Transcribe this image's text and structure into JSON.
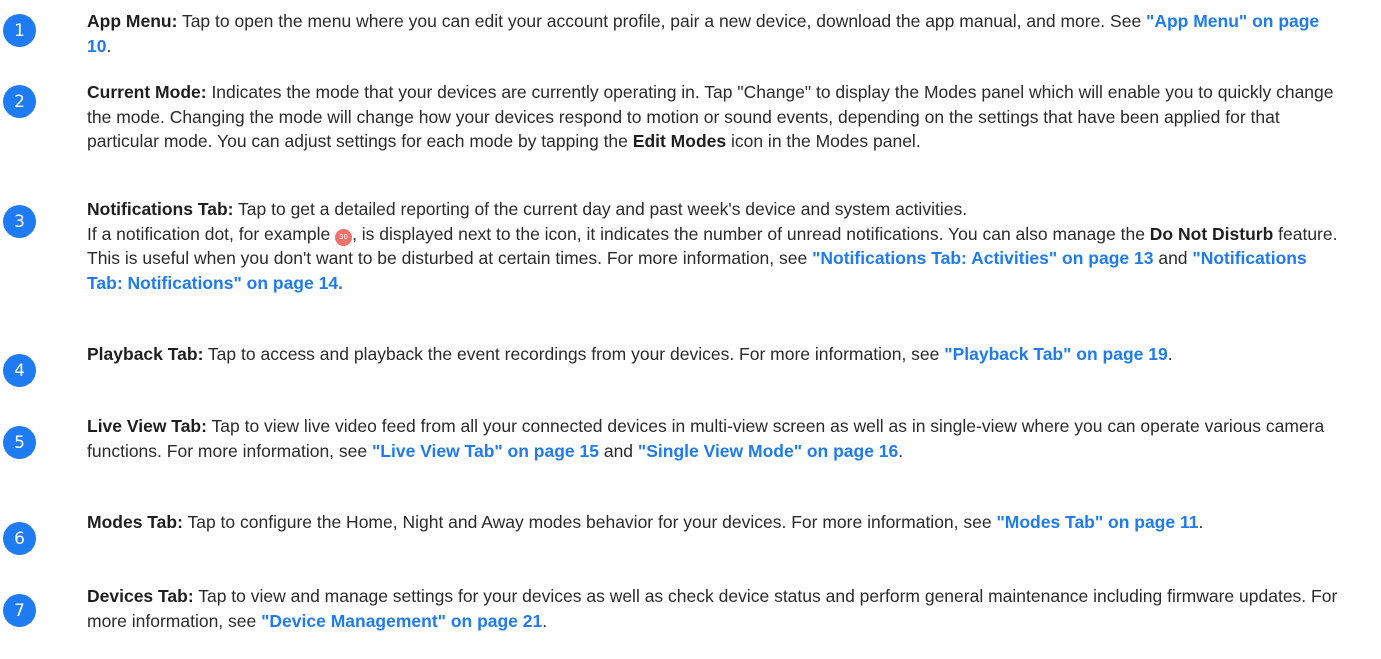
{
  "items": [
    {
      "number": "1",
      "label": "App Menu:",
      "t1": " Tap to open the menu where you can edit your account profile, pair a new device, download the app manual, and more. See ",
      "link": "\"App Menu\" on page 10",
      "t2": "."
    },
    {
      "number": "2",
      "label": "Current Mode:",
      "t1": " Indicates the mode that your devices are currently operating in. Tap \"Change\" to display the Modes panel which will enable you to quickly change the mode. Changing the mode will change how your devices respond to motion or sound events, depending on the settings that have been applied for that particular mode. You can adjust settings for each mode by tapping the ",
      "bold": "Edit Modes",
      "t2": " icon in the Modes panel."
    },
    {
      "number": "3",
      "label": "Notifications Tab:",
      "t1": " Tap to get a detailed reporting of the current day and past week's device and system activities.",
      "t2": "If a notification dot, for example ",
      "dot": "30",
      "t3": ", is displayed next to the icon, it indicates the number of unread notifications. You can also manage the ",
      "bold": "Do Not Disturb",
      "t4": " feature. This is useful when you don't want to be disturbed at certain times. For more information, see ",
      "link1": "\"Notifications Tab: Activities\" on page 13",
      "t5": " and ",
      "link2": "\"Notifications Tab: Notifications\" on page 14."
    },
    {
      "number": "4",
      "label": "Playback Tab:",
      "t1": " Tap to access and playback the event recordings from your devices. For more information, see ",
      "link": "\"Playback Tab\" on page 19",
      "t2": "."
    },
    {
      "number": "5",
      "label": "Live View Tab:",
      "t1": " Tap to view live video feed from all your connected devices in multi-view screen as well as in single-view where you can operate various camera functions. For more information, see ",
      "link1": "\"Live View Tab\" on page 15",
      "t2": " and ",
      "link2": "\"Single View Mode\" on page 16",
      "t3": "."
    },
    {
      "number": "6",
      "label": "Modes Tab:",
      "t1": " Tap to configure the Home, Night and Away modes behavior for your devices. For more information, see ",
      "link": "\"Modes Tab\" on page 11",
      "t2": "."
    },
    {
      "number": "7",
      "label": "Devices Tab:",
      "t1": " Tap to view and manage settings for your devices as well as check device status and perform general maintenance including firmware updates. For more information, see ",
      "link": "\"Device Management\" on page 21",
      "t2": "."
    }
  ]
}
